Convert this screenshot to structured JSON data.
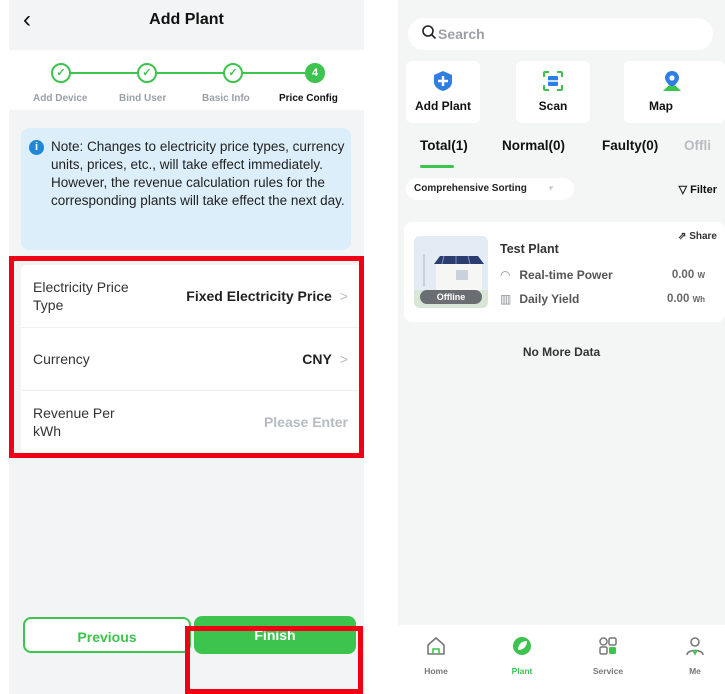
{
  "left_screen": {
    "header": {
      "title": "Add Plant",
      "back_icon": "chevron-left-icon"
    },
    "steps": [
      {
        "label": "Add Device",
        "done": true
      },
      {
        "label": "Bind User",
        "done": true
      },
      {
        "label": "Basic Info",
        "done": true
      },
      {
        "label": "Price Config",
        "number": "4",
        "active": true
      }
    ],
    "note": "Note: Changes to electricity price types, currency units, prices, etc., will take effect immediately. However, the revenue calculation rules for the corresponding plants will take effect the next day.",
    "form": [
      {
        "label": "Electricity Price Type",
        "value": "Fixed Electricity Price",
        "chevron": ">"
      },
      {
        "label": "Currency",
        "value": "CNY",
        "chevron": ">"
      },
      {
        "label": "Revenue Per kWh",
        "placeholder": "Please Enter"
      }
    ],
    "buttons": {
      "previous": "Previous",
      "finish": "Finish"
    }
  },
  "right_screen": {
    "search_placeholder": "Search",
    "quick_actions": [
      {
        "label": "Add Plant",
        "icon": "plus-shield-icon"
      },
      {
        "label": "Scan",
        "icon": "scan-icon"
      },
      {
        "label": "Map",
        "icon": "map-pin-icon"
      }
    ],
    "tabs": [
      "Total(1)",
      "Normal(0)",
      "Faulty(0)",
      "Offli"
    ],
    "sort_label": "Comprehensive Sorting",
    "filter_label": "Filter",
    "plant": {
      "name": "Test Plant",
      "status": "Offline",
      "share": "Share",
      "realtime_power_label": "Real-time Power",
      "realtime_power_value": "0.00",
      "realtime_power_unit": "W",
      "daily_yield_label": "Daily Yield",
      "daily_yield_value": "0.00",
      "daily_yield_unit": "Wh"
    },
    "no_more": "No More Data",
    "nav": [
      "Home",
      "Plant",
      "Service",
      "Me"
    ]
  },
  "colors": {
    "accent": "#3cc44f",
    "highlight": "#f00015",
    "info": "#1f86d8"
  }
}
